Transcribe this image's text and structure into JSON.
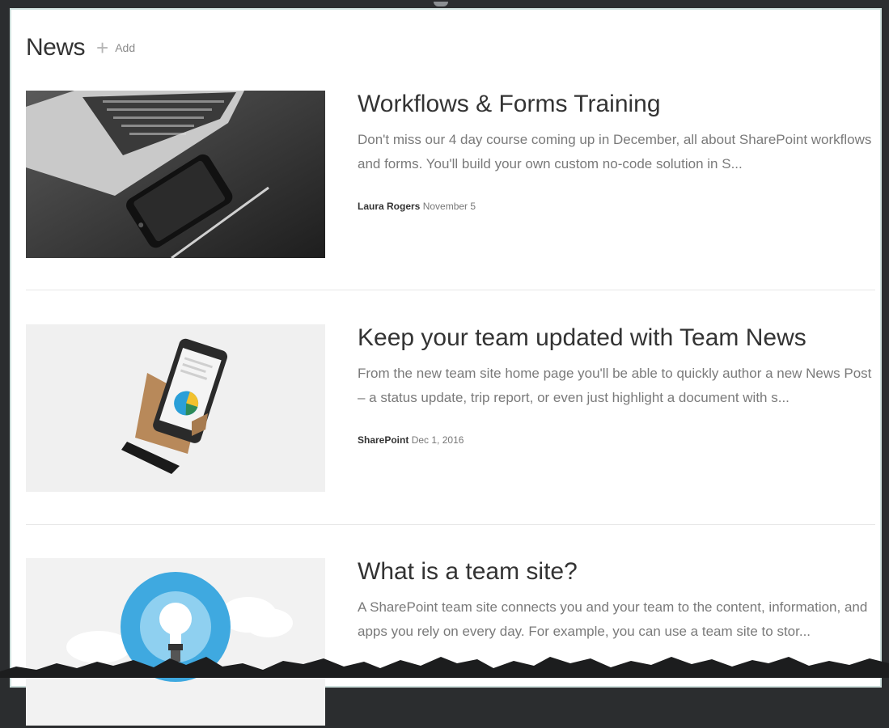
{
  "header": {
    "title": "News",
    "add_label": "Add"
  },
  "news": [
    {
      "title": "Workflows & Forms Training",
      "description": "Don't miss our 4 day course coming up in December, all about SharePoint workflows and forms.  You'll build your own custom no-code solution in S...",
      "author": "Laura Rogers",
      "date": "November 5"
    },
    {
      "title": "Keep your team updated with Team News",
      "description": "From the new team site home page you'll be able to quickly author a new News Post – a status update, trip report, or even just highlight a document with s...",
      "author": "SharePoint",
      "date": "Dec 1, 2016"
    },
    {
      "title": "What is a team site?",
      "description": "A SharePoint team site connects you and your team to the content, information, and apps you rely on every day. For example, you can use a team site to stor..."
    }
  ]
}
